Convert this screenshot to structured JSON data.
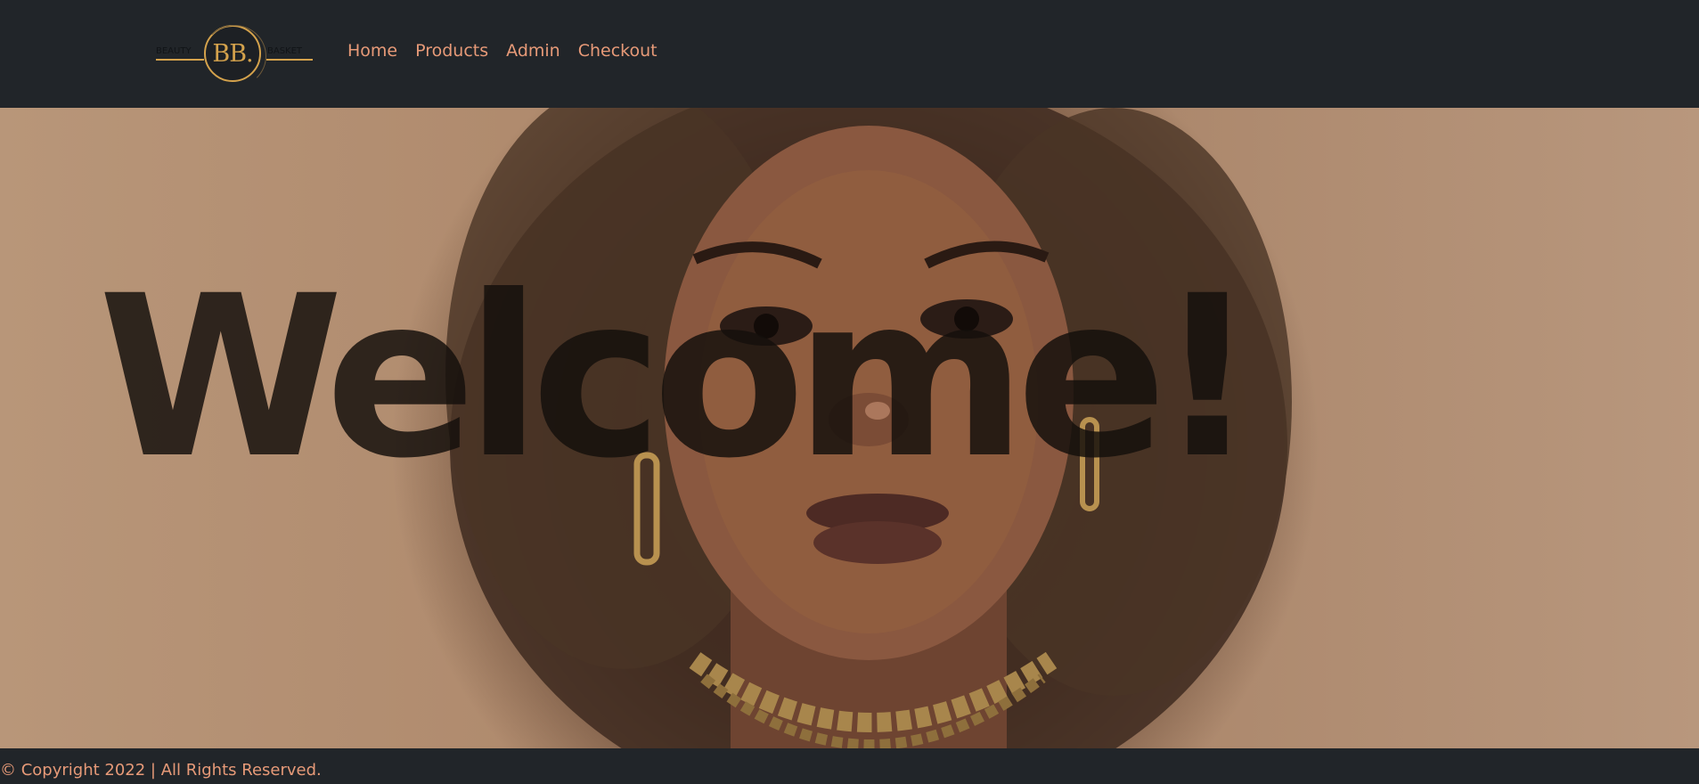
{
  "brand": {
    "left_word": "BEAUTY",
    "monogram": "BB.",
    "right_word": "BASKET"
  },
  "nav": {
    "items": [
      {
        "label": "Home"
      },
      {
        "label": "Products"
      },
      {
        "label": "Admin"
      },
      {
        "label": "Checkout"
      }
    ]
  },
  "hero": {
    "heading": "Welcome!",
    "image_subject": "portrait of a woman with curly hair and gold earrings"
  },
  "footer": {
    "copyright": "© Copyright 2022 | All Rights Reserved."
  },
  "colors": {
    "navbar_bg": "#212529",
    "nav_link": "#e79a78",
    "brand_gold": "#d4a24c",
    "heading_text": "#140f0c"
  }
}
